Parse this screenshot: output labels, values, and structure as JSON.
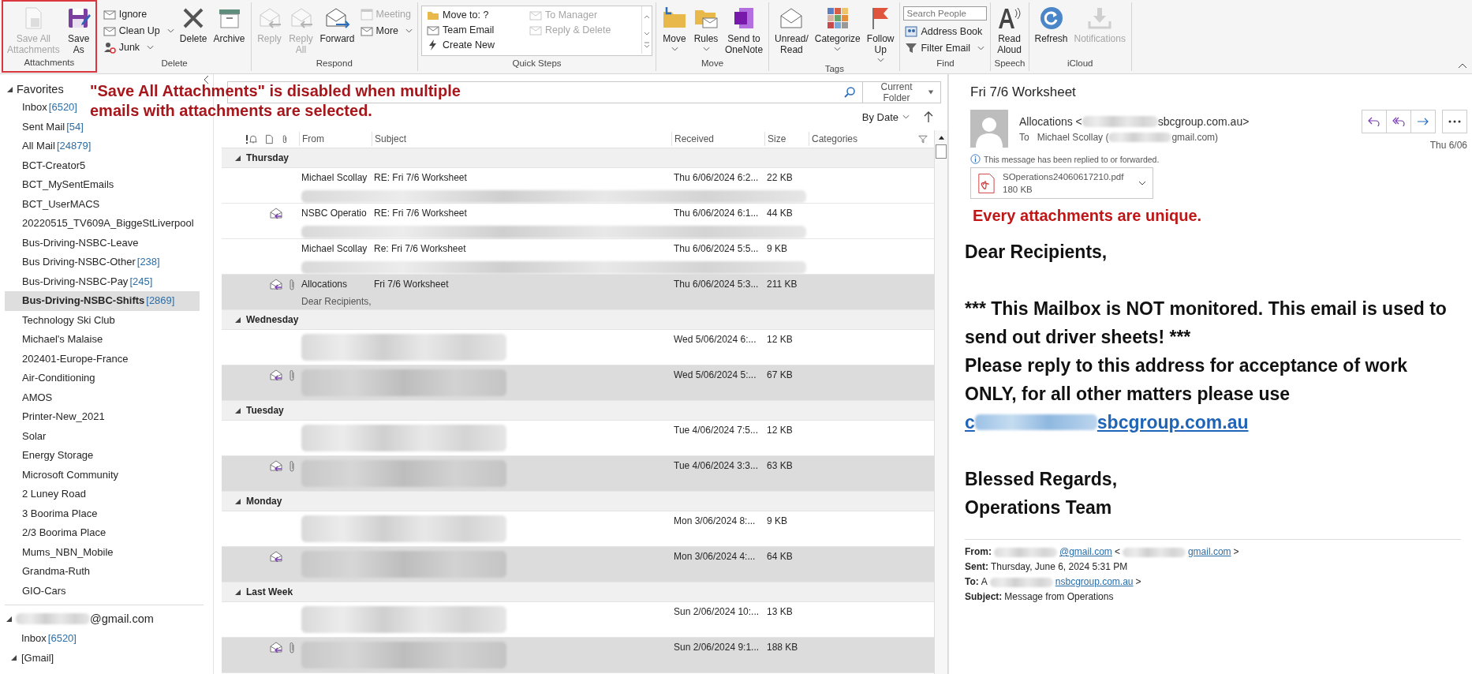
{
  "ribbon": {
    "groups": [
      {
        "label": "Attachments",
        "highlighted": true,
        "items": [
          {
            "kind": "large",
            "label": "Save All\nAttachments",
            "disabled": true,
            "dropdown": false
          },
          {
            "kind": "large",
            "label": "Save\nAs",
            "disabled": false,
            "dropdown": false
          }
        ]
      },
      {
        "label": "Delete",
        "highlighted": false,
        "items": [
          {
            "kind": "stack",
            "items": [
              {
                "label": "Ignore",
                "disabled": false,
                "dropdown": false
              },
              {
                "label": "Clean Up",
                "disabled": false,
                "dropdown": true
              },
              {
                "label": "Junk",
                "disabled": false,
                "dropdown": true
              }
            ]
          },
          {
            "kind": "large",
            "label": "Delete",
            "disabled": false,
            "dropdown": false
          },
          {
            "kind": "large",
            "label": "Archive",
            "disabled": false,
            "dropdown": false
          }
        ]
      },
      {
        "label": "Respond",
        "highlighted": false,
        "items": [
          {
            "kind": "large",
            "label": "Reply",
            "disabled": true,
            "dropdown": false
          },
          {
            "kind": "large",
            "label": "Reply\nAll",
            "disabled": true,
            "dropdown": false
          },
          {
            "kind": "large",
            "label": "Forward",
            "disabled": false,
            "dropdown": false
          },
          {
            "kind": "stack",
            "items": [
              {
                "label": "Meeting",
                "disabled": true,
                "dropdown": false
              },
              {
                "label": "More",
                "disabled": false,
                "dropdown": true
              }
            ]
          }
        ]
      },
      {
        "label": "Quick Steps",
        "highlighted": false,
        "items": [
          {
            "kind": "gallery",
            "items": [
              {
                "label": "Move to: ?",
                "disabled": false,
                "dropdown": false
              },
              {
                "label": "To Manager",
                "disabled": true,
                "dropdown": false
              },
              {
                "label": "Team Email",
                "disabled": false,
                "dropdown": false
              },
              {
                "label": "Reply & Delete",
                "disabled": true,
                "dropdown": false
              },
              {
                "label": "Create New",
                "disabled": false,
                "dropdown": false
              }
            ]
          }
        ]
      },
      {
        "label": "Move",
        "highlighted": false,
        "items": [
          {
            "kind": "large",
            "label": "Move",
            "disabled": false,
            "dropdown": true
          },
          {
            "kind": "large",
            "label": "Rules",
            "disabled": false,
            "dropdown": true
          },
          {
            "kind": "large",
            "label": "Send to\nOneNote",
            "disabled": false,
            "dropdown": false
          }
        ]
      },
      {
        "label": "Tags",
        "highlighted": false,
        "items": [
          {
            "kind": "large",
            "label": "Unread/\nRead",
            "disabled": false,
            "dropdown": false
          },
          {
            "kind": "large",
            "label": "Categorize",
            "disabled": false,
            "dropdown": true
          },
          {
            "kind": "large",
            "label": "Follow\nUp",
            "disabled": false,
            "dropdown": true
          }
        ]
      },
      {
        "label": "Find",
        "highlighted": false,
        "items": [
          {
            "kind": "stack",
            "search": {
              "placeholder": "Search People"
            },
            "items": [
              {
                "label": "Address Book",
                "disabled": false,
                "dropdown": false
              },
              {
                "label": "Filter Email",
                "disabled": false,
                "dropdown": true
              }
            ]
          }
        ]
      },
      {
        "label": "Speech",
        "highlighted": false,
        "items": [
          {
            "kind": "large",
            "label": "Read\nAloud",
            "disabled": false,
            "dropdown": false
          }
        ]
      },
      {
        "label": "iCloud",
        "highlighted": false,
        "items": [
          {
            "kind": "large",
            "label": "Refresh",
            "disabled": false,
            "dropdown": false
          },
          {
            "kind": "large",
            "label": "Notifications",
            "disabled": true,
            "dropdown": false
          }
        ]
      }
    ]
  },
  "annotation": "\"Save All Attachments\" is disabled when multiple emails with attachments are selected.",
  "sidebar": {
    "favorites_label": "Favorites",
    "items": [
      {
        "name": "Inbox",
        "count": "[6520]",
        "selected": false
      },
      {
        "name": "Sent Mail",
        "count": "[54]",
        "selected": false
      },
      {
        "name": "All Mail",
        "count": "[24879]",
        "selected": false
      },
      {
        "name": "BCT-Creator5",
        "selected": false
      },
      {
        "name": "BCT_MySentEmails",
        "selected": false
      },
      {
        "name": "BCT_UserMACS",
        "selected": false
      },
      {
        "name": "20220515_TV609A_BiggeStLiverpool",
        "selected": false
      },
      {
        "name": "Bus-Driving-NSBC-Leave",
        "selected": false
      },
      {
        "name": "Bus Driving-NSBC-Other",
        "count": "[238]",
        "selected": false
      },
      {
        "name": "Bus-Driving-NSBC-Pay",
        "count": "[245]",
        "selected": false
      },
      {
        "name": "Bus-Driving-NSBC-Shifts",
        "count": "[2869]",
        "selected": true
      },
      {
        "name": "Technology Ski Club",
        "selected": false
      },
      {
        "name": "Michael's Malaise",
        "selected": false
      },
      {
        "name": "202401-Europe-France",
        "selected": false
      },
      {
        "name": "Air-Conditioning",
        "selected": false
      },
      {
        "name": "AMOS",
        "selected": false
      },
      {
        "name": "Printer-New_2021",
        "selected": false
      },
      {
        "name": "Solar",
        "selected": false
      },
      {
        "name": "Energy Storage",
        "selected": false
      },
      {
        "name": "Microsoft Community",
        "selected": false
      },
      {
        "name": "2 Luney Road",
        "selected": false
      },
      {
        "name": "3 Boorima Place",
        "selected": false
      },
      {
        "name": "2/3 Boorima Place",
        "selected": false
      },
      {
        "name": "Mums_NBN_Mobile",
        "selected": false
      },
      {
        "name": "Grandma-Ruth",
        "selected": false
      },
      {
        "name": "GIO-Cars",
        "selected": false
      }
    ],
    "account": "@gmail.com",
    "account_items": [
      {
        "name": "Inbox",
        "count": "[6520]",
        "expanded": false,
        "selected": false
      },
      {
        "name": "[Gmail]",
        "expanded": true,
        "selected": false
      }
    ]
  },
  "list": {
    "scope": "Current Folder",
    "sort": "By Date",
    "columns": [
      "From",
      "Subject",
      "Received",
      "Size",
      "Categories"
    ],
    "groups": [
      {
        "label": "Thursday",
        "rows": [
          {
            "from": "Michael Scollay",
            "subject": "RE: Fri 7/6 Worksheet",
            "received": "Thu 6/06/2024 6:2...",
            "size": "22 KB",
            "replied": false,
            "attachment": false,
            "selected": false,
            "redacted": true
          },
          {
            "from": "NSBC Operatio",
            "subject": "RE: Fri 7/6 Worksheet",
            "received": "Thu 6/06/2024 6:1...",
            "size": "44 KB",
            "replied": true,
            "attachment": false,
            "selected": false,
            "redacted": true
          },
          {
            "from": "Michael Scollay",
            "subject": "Re: Fri 7/6 Worksheet",
            "received": "Thu 6/06/2024 5:5...",
            "size": "9 KB",
            "replied": false,
            "attachment": false,
            "selected": false,
            "redacted": true
          },
          {
            "from": "Allocations",
            "subject": "Fri 7/6 Worksheet",
            "preview": "Dear Recipients,",
            "received": "Thu 6/06/2024 5:3...",
            "size": "211 KB",
            "replied": true,
            "attachment": true,
            "selected": true,
            "redacted": false
          }
        ]
      },
      {
        "label": "Wednesday",
        "rows": [
          {
            "received": "Wed 5/06/2024 6:...",
            "size": "12 KB",
            "replied": false,
            "attachment": false,
            "selected": false,
            "redacted": true
          },
          {
            "received": "Wed 5/06/2024 5:...",
            "size": "67 KB",
            "replied": true,
            "attachment": true,
            "selected": true,
            "redacted": true
          }
        ]
      },
      {
        "label": "Tuesday",
        "rows": [
          {
            "received": "Tue 4/06/2024 7:5...",
            "size": "12 KB",
            "replied": false,
            "attachment": false,
            "selected": false,
            "redacted": true
          },
          {
            "received": "Tue 4/06/2024 3:3...",
            "size": "63 KB",
            "replied": true,
            "attachment": true,
            "selected": true,
            "redacted": true
          }
        ]
      },
      {
        "label": "Monday",
        "rows": [
          {
            "received": "Mon 3/06/2024 8:...",
            "size": "9 KB",
            "replied": false,
            "attachment": false,
            "selected": false,
            "redacted": true
          },
          {
            "received": "Mon 3/06/2024 4:...",
            "size": "64 KB",
            "replied": true,
            "attachment": false,
            "selected": true,
            "redacted": true
          }
        ]
      },
      {
        "label": "Last Week",
        "rows": [
          {
            "received": "Sun 2/06/2024 10:...",
            "size": "13 KB",
            "replied": false,
            "attachment": false,
            "selected": false,
            "redacted": true
          },
          {
            "received": "Sun 2/06/2024 9:1...",
            "size": "188 KB",
            "replied": true,
            "attachment": true,
            "selected": true,
            "redacted": true
          }
        ]
      }
    ]
  },
  "reading_pane": {
    "subject": "Fri 7/6 Worksheet",
    "sender": [
      {
        "kind": "text",
        "text": "Allocations <"
      },
      {
        "kind": "blur"
      },
      {
        "kind": "text",
        "text": "sbcgroup.com.au>"
      }
    ],
    "to_label": "To",
    "to": [
      {
        "kind": "text",
        "text": "Michael Scollay ("
      },
      {
        "kind": "blur"
      },
      {
        "kind": "text",
        "text": "gmail.com)"
      }
    ],
    "date": "Thu 6/06",
    "info": "This message has been replied to or forwarded.",
    "attachment": {
      "name": "SOperations24060617210.pdf",
      "size": "180 KB"
    },
    "note": "Every attachments are unique.",
    "greeting": "Dear Recipients,",
    "paragraphs": [
      "*** This Mailbox is NOT monitored. This email is used to send out driver sheets! ***",
      "Please reply to this address for acceptance of work ONLY, for all other matters please use"
    ],
    "link": [
      {
        "kind": "text",
        "text": "c"
      },
      {
        "kind": "blur"
      },
      {
        "kind": "text",
        "text": "sbcgroup.com.au"
      }
    ],
    "signoff": "Blessed Regards,",
    "team": "Operations Team",
    "footer": [
      {
        "label": "From:",
        "parts": [
          {
            "kind": "blur"
          },
          {
            "kind": "link",
            "text": "@gmail.com"
          },
          {
            "kind": "text",
            "text": "<"
          },
          {
            "kind": "blur"
          },
          {
            "kind": "link",
            "text": "gmail.com"
          },
          {
            "kind": "text",
            "text": ">"
          }
        ]
      },
      {
        "label": "Sent:",
        "parts": [
          {
            "kind": "text",
            "text": "Thursday, June 6, 2024 5:31 PM"
          }
        ]
      },
      {
        "label": "To:",
        "parts": [
          {
            "kind": "text",
            "text": "A"
          },
          {
            "kind": "blur"
          },
          {
            "kind": "link",
            "text": "nsbcgroup.com.au"
          },
          {
            "kind": "text",
            "text": ">"
          }
        ]
      },
      {
        "label": "Subject:",
        "parts": [
          {
            "kind": "text",
            "text": "Message from Operations"
          }
        ]
      }
    ]
  }
}
